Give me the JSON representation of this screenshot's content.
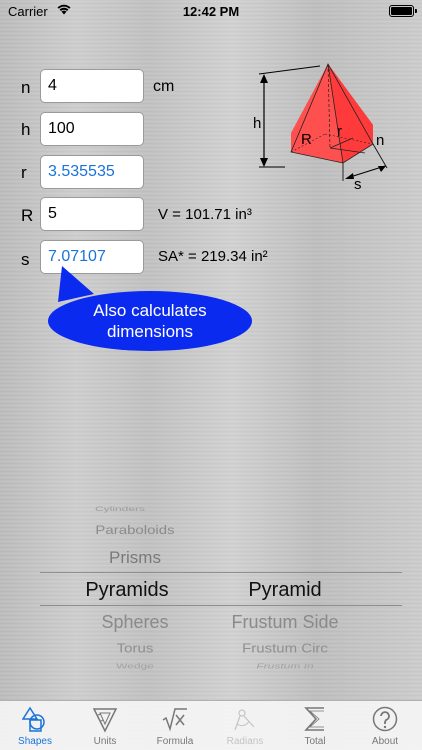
{
  "status": {
    "carrier": "Carrier",
    "time": "12:42 PM"
  },
  "fields": {
    "n": {
      "label": "n",
      "value": "4"
    },
    "h": {
      "label": "h",
      "value": "100"
    },
    "r": {
      "label": "r",
      "value": "3.535535"
    },
    "R": {
      "label": "R",
      "value": "5"
    },
    "s": {
      "label": "s",
      "value": "7.07107"
    }
  },
  "unit": "cm",
  "results": {
    "volume": "V = 101.71 in³",
    "surface_area": "SA* = 219.34 in²"
  },
  "bubble": {
    "line1": "Also calculates",
    "line2": "dimensions"
  },
  "diagram": {
    "h": "h",
    "R": "R",
    "r": "r",
    "n": "n",
    "s": "s",
    "fill_color": "#ff2020"
  },
  "picker": {
    "shapes": [
      "Cylinders",
      "Paraboloids",
      "Prisms",
      "Pyramids",
      "Spheres",
      "Torus",
      "Wedge"
    ],
    "selected_shape": "Pyramids",
    "variants": [
      "Pyramid",
      "Frustum Side",
      "Frustum Circ",
      "Frustum In"
    ],
    "selected_variant": "Pyramid"
  },
  "tabs": [
    {
      "label": "Shapes",
      "icon": "shapes-icon",
      "state": "active"
    },
    {
      "label": "Units",
      "icon": "units-icon",
      "state": "normal"
    },
    {
      "label": "Formula",
      "icon": "formula-icon",
      "state": "normal"
    },
    {
      "label": "Radians",
      "icon": "radians-icon",
      "state": "disabled"
    },
    {
      "label": "Total",
      "icon": "sigma-icon",
      "state": "normal"
    },
    {
      "label": "About",
      "icon": "question-icon",
      "state": "normal"
    }
  ],
  "colors": {
    "accent": "#1a73d9",
    "bubble": "#0b2af0"
  }
}
